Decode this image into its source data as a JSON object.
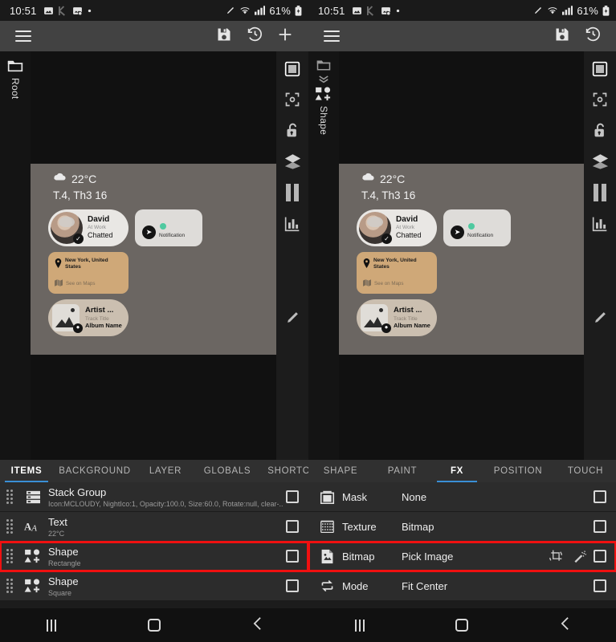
{
  "meta": {
    "accent_color": "#3a8fd6",
    "highlight_color": "#f01010",
    "toolbar_bg": "#424242",
    "row_bg": "#2c2c2c"
  },
  "status_bar": {
    "clock": "10:51",
    "battery_text": "61%",
    "left_icons": [
      "image-icon",
      "k-app-icon",
      "screenshot-icon",
      "dot-icon"
    ],
    "right_icons": [
      "pencil-icon",
      "wifi-icon",
      "signal-icon",
      "battery-icon"
    ]
  },
  "left_panel": {
    "toolbar": {
      "menu_label": "menu-icon",
      "save_label": "save-icon",
      "history_label": "history-icon",
      "add_label": "add-icon"
    },
    "tree": {
      "icon": "folder-icon",
      "label": "Root"
    },
    "tools": [
      "square-icon",
      "focus-icon",
      "unlock-icon",
      "layers-icon",
      "pause-icon",
      "chart-icon"
    ],
    "edit_fab": "pencil-icon",
    "widget": {
      "weather_icon": "cloud-icon",
      "temperature": "22°C",
      "date": "T.4, Th3 16",
      "person": {
        "name": "David",
        "status": "At Work",
        "action": "Chatted",
        "badge": "check-icon"
      },
      "notification": {
        "label": "Notification",
        "icon": "telegram-icon"
      },
      "location": {
        "title": "New York, United States",
        "action": "See on Maps",
        "pin_icon": "pin-icon",
        "map_icon": "map-icon"
      },
      "music": {
        "artist": "Artist ...",
        "track": "Track Title",
        "album": "Album Name",
        "badge": "disc-icon"
      }
    },
    "tabs": [
      {
        "label": "ITEMS",
        "active": true
      },
      {
        "label": "BACKGROUND",
        "active": false
      },
      {
        "label": "LAYER",
        "active": false
      },
      {
        "label": "GLOBALS",
        "active": false
      },
      {
        "label": "SHORTCU",
        "active": false
      }
    ],
    "items": [
      {
        "title": "Stack Group",
        "subtitle": "Icon:MCLOUDY, NightIco:1, Opacity:100.0, Size:60.0, Rotate:null, clear-..",
        "icon": "stack-group-icon",
        "highlighted": false
      },
      {
        "title": "Text",
        "subtitle": "22°C",
        "icon": "text-icon",
        "highlighted": false
      },
      {
        "title": "Shape",
        "subtitle": "Rectangle",
        "icon": "shape-icon",
        "highlighted": true
      },
      {
        "title": "Shape",
        "subtitle": "Square",
        "icon": "shape-icon",
        "highlighted": false
      }
    ]
  },
  "right_panel": {
    "toolbar": {
      "menu_label": "menu-icon",
      "save_label": "save-icon",
      "history_label": "history-icon"
    },
    "tree": {
      "icon": "folder-icon",
      "chevron": "chevron-down-icon",
      "shape_icon": "shape-icon",
      "label": "Shape"
    },
    "tools": [
      "square-icon",
      "focus-icon",
      "unlock-icon",
      "layers-icon",
      "pause-icon",
      "chart-icon"
    ],
    "edit_fab": "pencil-icon",
    "widget": {
      "weather_icon": "cloud-icon",
      "temperature": "22°C",
      "date": "T.4, Th3 16",
      "person": {
        "name": "David",
        "status": "At Work",
        "action": "Chatted",
        "badge": "check-icon"
      },
      "notification": {
        "label": "Notification",
        "icon": "telegram-icon"
      },
      "location": {
        "title": "New York, United States",
        "action": "See on Maps",
        "pin_icon": "pin-icon",
        "map_icon": "map-icon"
      },
      "music": {
        "artist": "Artist ...",
        "track": "Track Title",
        "album": "Album Name",
        "badge": "disc-icon"
      }
    },
    "tabs": [
      {
        "label": "SHAPE",
        "active": false
      },
      {
        "label": "PAINT",
        "active": false
      },
      {
        "label": "FX",
        "active": true
      },
      {
        "label": "POSITION",
        "active": false
      },
      {
        "label": "TOUCH",
        "active": false
      }
    ],
    "fx_rows": [
      {
        "label": "Mask",
        "value": "None",
        "icon": "mask-icon",
        "highlighted": false,
        "actions": []
      },
      {
        "label": "Texture",
        "value": "Bitmap",
        "icon": "texture-icon",
        "highlighted": false,
        "actions": []
      },
      {
        "label": "Bitmap",
        "value": "Pick Image",
        "icon": "bitmap-icon",
        "highlighted": true,
        "actions": [
          "crop-rotate-icon",
          "magic-wand-icon"
        ]
      },
      {
        "label": "Mode",
        "value": "Fit Center",
        "icon": "mode-icon",
        "highlighted": false,
        "actions": []
      }
    ]
  },
  "nav_bar": {
    "recents": "recents-icon",
    "home": "home-icon",
    "back": "back-icon"
  }
}
